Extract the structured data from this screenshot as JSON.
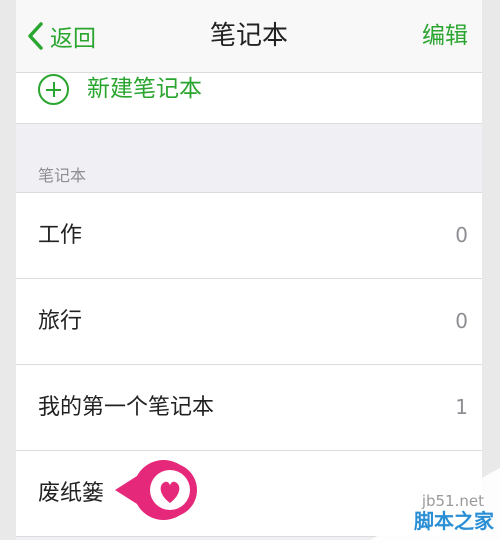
{
  "navbar": {
    "back_label": "返回",
    "title": "笔记本",
    "edit_label": "编辑"
  },
  "new_notebook": {
    "label": "新建笔记本"
  },
  "section": {
    "header": "笔记本"
  },
  "notebooks": [
    {
      "name": "工作",
      "count": "0"
    },
    {
      "name": "旅行",
      "count": "0"
    },
    {
      "name": "我的第一个笔记本",
      "count": "1"
    },
    {
      "name": "废纸篓",
      "count": ""
    }
  ],
  "watermark": {
    "site": "jb51.net",
    "name": "脚本之家"
  },
  "colors": {
    "accent": "#2aa52f",
    "callout": "#e6287a",
    "watermark_blue": "#2b8fd6"
  }
}
